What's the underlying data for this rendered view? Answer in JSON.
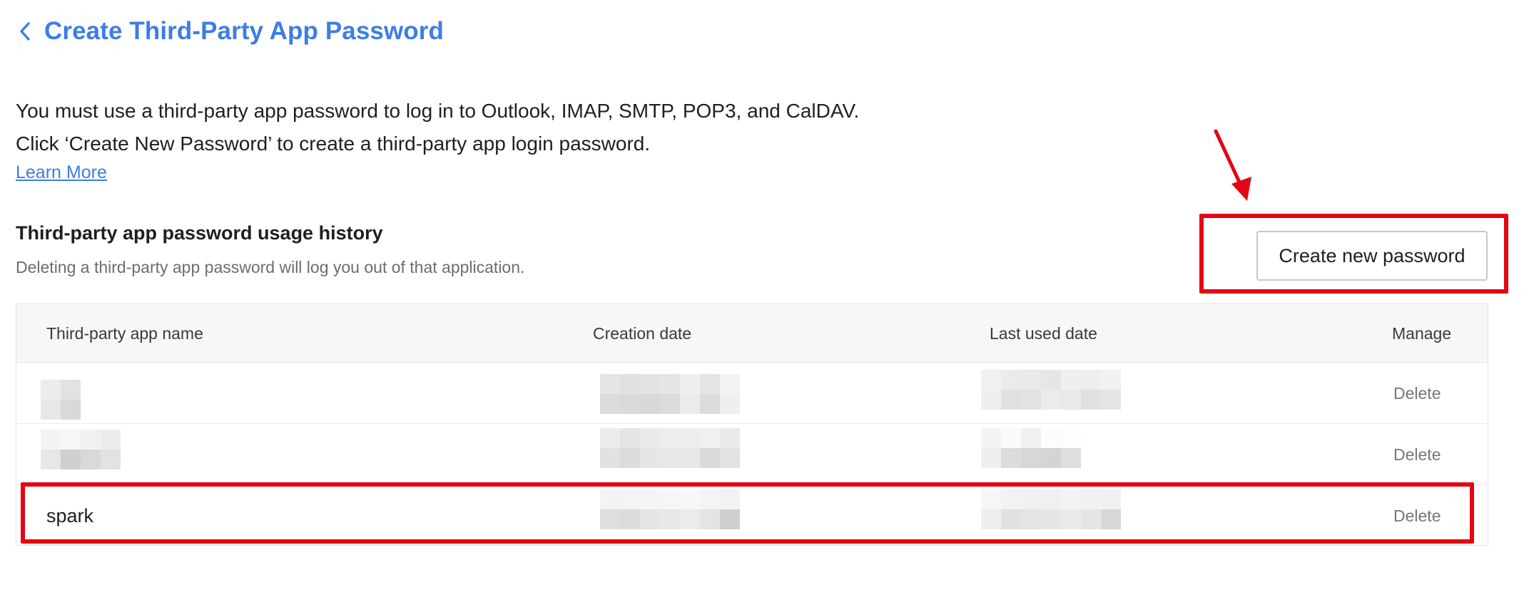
{
  "header": {
    "title": "Create Third-Party App Password",
    "back_icon": "chevron-left-icon"
  },
  "intro": {
    "line1": "You must use a third-party app password to log in to Outlook, IMAP, SMTP, POP3, and CalDAV.",
    "line2": "Click ‘Create New Password’ to create a third-party app login password.",
    "learn_more": "Learn More"
  },
  "section": {
    "title": "Third-party app password usage history",
    "description": "Deleting a third-party app password will log you out of that application.",
    "create_button": "Create new password"
  },
  "table": {
    "columns": [
      "Third-party app name",
      "Creation date",
      "Last used date",
      "Manage"
    ],
    "rows": [
      {
        "name": "",
        "created": "",
        "last_used": "",
        "action": "Delete"
      },
      {
        "name": "",
        "created": "",
        "last_used": "",
        "action": "Delete"
      },
      {
        "name": "spark",
        "created": "",
        "last_used": "",
        "action": "Delete"
      }
    ]
  },
  "colors": {
    "accent": "#3d7de6",
    "annotation": "#e30613"
  }
}
